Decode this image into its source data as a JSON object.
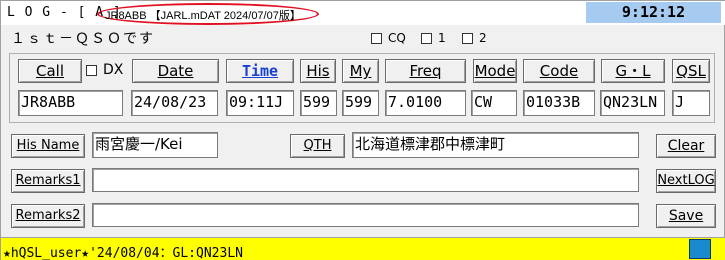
{
  "titlebar": {
    "app_title": "L O G - [ A ]",
    "version_label": "JR8ABB 【JARL.mDAT 2024/07/07版】",
    "clock": "9:12:12"
  },
  "message": "１ｓｔ－ＱＳＯです",
  "qsl_options": [
    {
      "label": "CQ",
      "checked": false
    },
    {
      "label": "1",
      "checked": false
    },
    {
      "label": "2",
      "checked": false
    }
  ],
  "columns": [
    {
      "label": "Call",
      "value": "JR8ABB"
    },
    {
      "label": "DX",
      "checked": false
    },
    {
      "label": "Date",
      "value": "24/08/23"
    },
    {
      "label": "Time",
      "value": "09:11J"
    },
    {
      "label": "His",
      "value": "599"
    },
    {
      "label": "My",
      "value": "599"
    },
    {
      "label": "Freq",
      "value": "7.0100"
    },
    {
      "label": "Mode",
      "value": "CW"
    },
    {
      "label": "Code",
      "value": "01033B"
    },
    {
      "label": "G・L",
      "value": "QN23LN"
    },
    {
      "label": "QSL",
      "value": "J"
    }
  ],
  "his_name": {
    "label": "His Name",
    "value": "雨宮慶一/Kei"
  },
  "qth": {
    "label": "QTH",
    "value": "北海道標津郡中標津町"
  },
  "remarks1": {
    "label": "Remarks1",
    "value": ""
  },
  "remarks2": {
    "label": "Remarks2",
    "value": ""
  },
  "buttons": {
    "clear": "Clear",
    "next_log": "NextLOG",
    "save": "Save"
  },
  "status_bar": "★hQSL_user★'24/08/04：GL:QN23LN",
  "colors": {
    "status_bg": "#ffff00",
    "clock_bg": "#a6caf0",
    "time_label": "#1a40d0",
    "highlight": "#e01020"
  }
}
